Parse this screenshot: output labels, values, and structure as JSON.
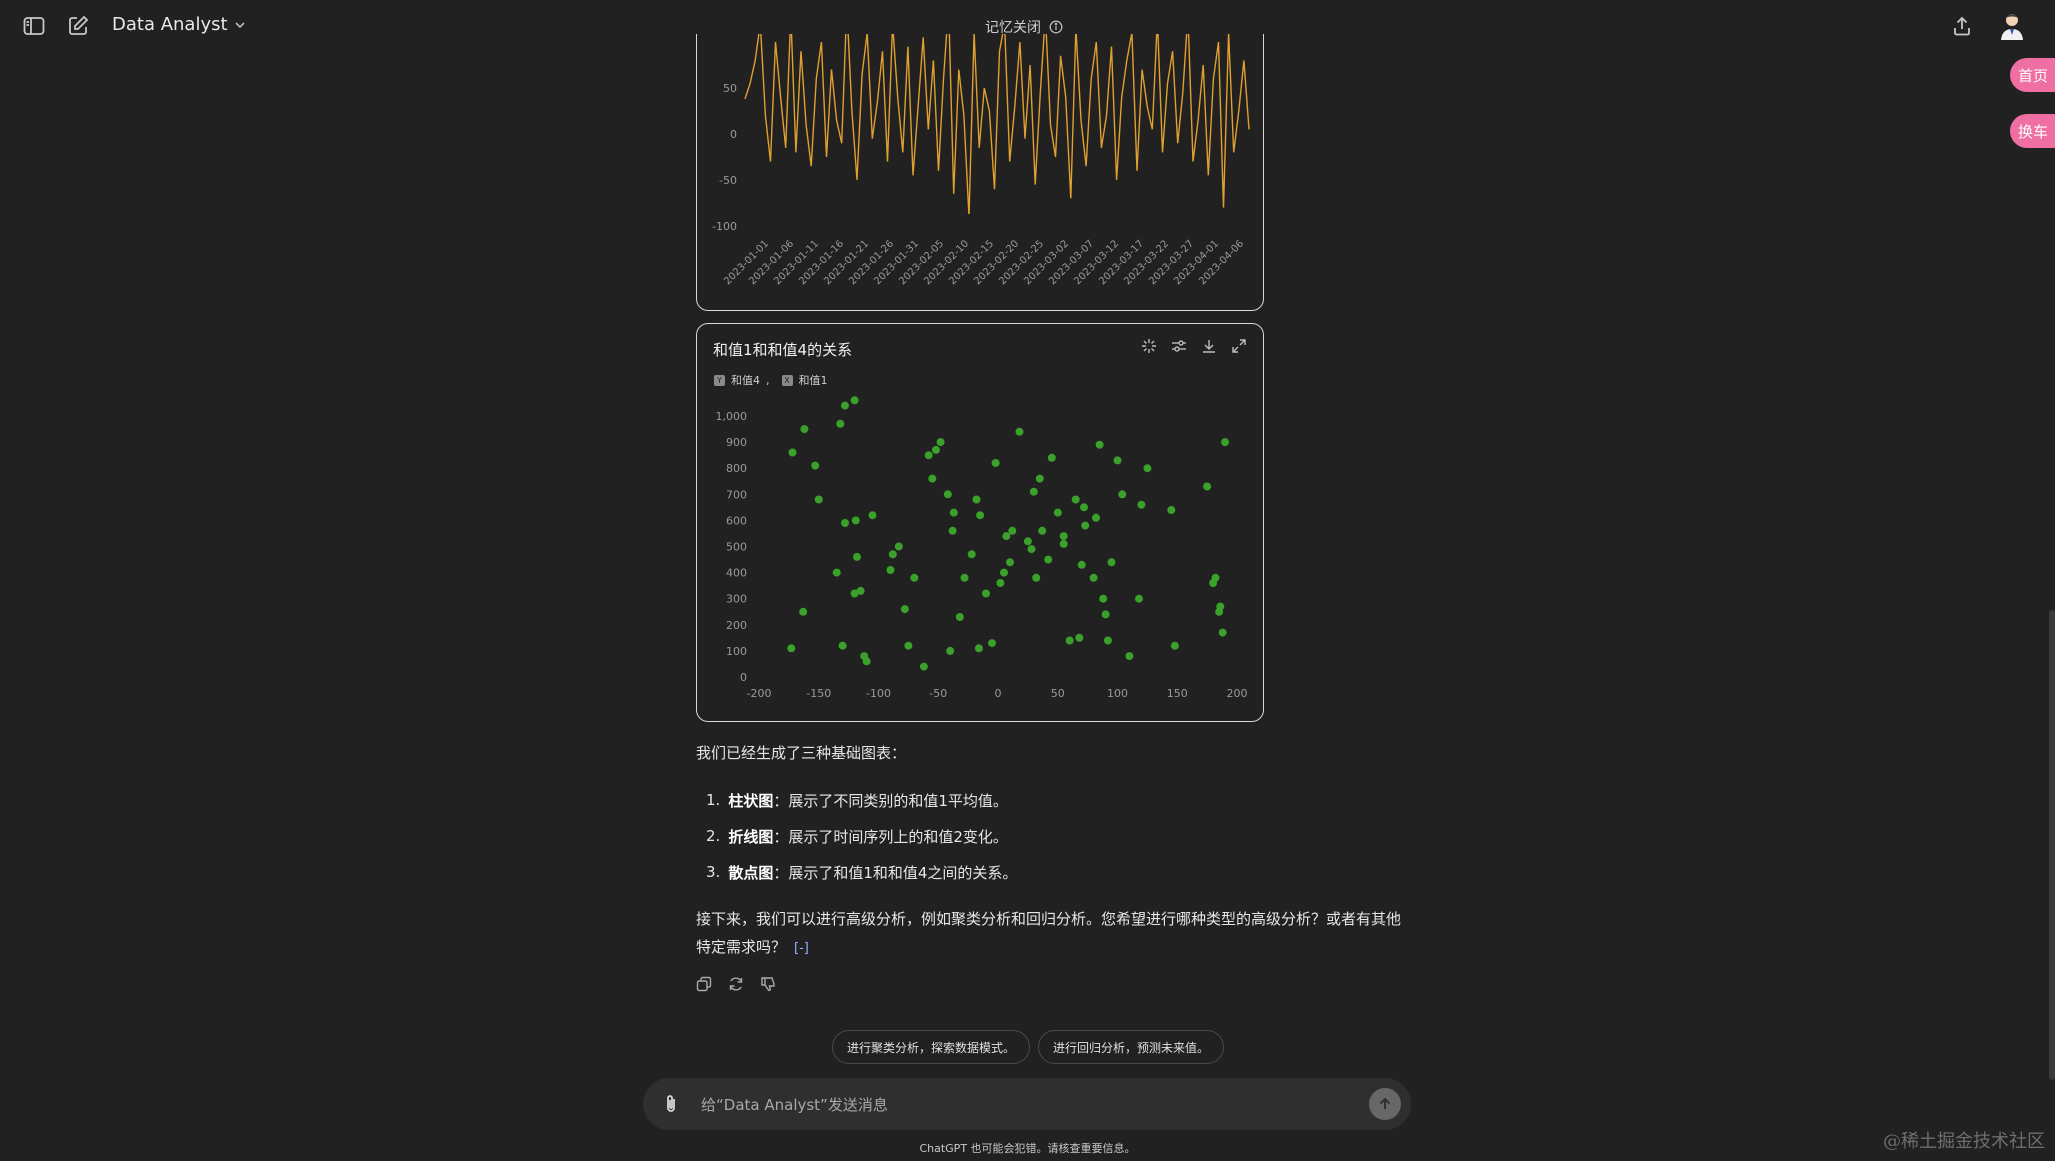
{
  "header": {
    "model_name": "Data Analyst",
    "memory_status": "记忆关闭"
  },
  "side_pills": {
    "home": "首页",
    "change": "换车"
  },
  "line_chart": {
    "y_ticks": [
      "50",
      "0",
      "-50",
      "-100"
    ],
    "x_ticks": [
      "2023-01-01",
      "2023-01-06",
      "2023-01-11",
      "2023-01-16",
      "2023-01-21",
      "2023-01-26",
      "2023-01-31",
      "2023-02-05",
      "2023-02-10",
      "2023-02-15",
      "2023-02-20",
      "2023-02-25",
      "2023-03-02",
      "2023-03-07",
      "2023-03-12",
      "2023-03-17",
      "2023-03-22",
      "2023-03-27",
      "2023-04-01",
      "2023-04-06"
    ]
  },
  "scatter_card": {
    "title": "和值1和和值4的关系",
    "legend_y_badge": "Y",
    "legend_y": "和值4",
    "legend_sep": ",",
    "legend_x_badge": "X",
    "legend_x": "和值1"
  },
  "chart_data": [
    {
      "type": "line",
      "y_ticks": [
        50,
        0,
        -50,
        -100
      ],
      "x_start": "2023-01-01",
      "x_end": "2023-04-10",
      "color": "#e0a030",
      "values": [
        38,
        55,
        80,
        120,
        20,
        -30,
        100,
        40,
        -15,
        130,
        -20,
        90,
        10,
        -35,
        60,
        100,
        -25,
        70,
        15,
        -10,
        140,
        25,
        -50,
        65,
        110,
        -5,
        35,
        90,
        -30,
        120,
        40,
        -20,
        95,
        -45,
        30,
        105,
        5,
        80,
        -40,
        60,
        140,
        -65,
        70,
        20,
        -90,
        110,
        -15,
        50,
        25,
        -60,
        90,
        120,
        -30,
        30,
        100,
        -5,
        75,
        -55,
        45,
        130,
        10,
        -25,
        85,
        40,
        -70,
        115,
        15,
        -35,
        60,
        100,
        -15,
        20,
        95,
        -50,
        40,
        80,
        110,
        -40,
        70,
        30,
        5,
        125,
        -20,
        55,
        90,
        -10,
        45,
        130,
        -30,
        15,
        75,
        -45,
        60,
        100,
        -80,
        110,
        -20,
        25,
        80,
        5
      ]
    },
    {
      "type": "scatter",
      "title": "和值1和和值4的关系",
      "x_label": "和值1",
      "y_label": "和值4",
      "xlim": [
        -200,
        200
      ],
      "ylim": [
        0,
        1000
      ],
      "x_ticks": [
        -200,
        -150,
        -100,
        -50,
        0,
        50,
        100,
        150,
        200
      ],
      "y_ticks": [
        "0",
        "100",
        "200",
        "300",
        "400",
        "500",
        "600",
        "700",
        "800",
        "900",
        "1,000"
      ],
      "color": "#3aa12a",
      "points": [
        [
          -172,
          860
        ],
        [
          -162,
          950
        ],
        [
          -153,
          810
        ],
        [
          -150,
          680
        ],
        [
          -173,
          110
        ],
        [
          -163,
          250
        ],
        [
          -135,
          400
        ],
        [
          -128,
          590
        ],
        [
          -120,
          320
        ],
        [
          -115,
          330
        ],
        [
          -118,
          460
        ],
        [
          -119,
          600
        ],
        [
          -110,
          60
        ],
        [
          -112,
          80
        ],
        [
          -130,
          120
        ],
        [
          -132,
          970
        ],
        [
          -128,
          1040
        ],
        [
          -120,
          1060
        ],
        [
          -105,
          620
        ],
        [
          -90,
          410
        ],
        [
          -88,
          470
        ],
        [
          -83,
          500
        ],
        [
          -78,
          260
        ],
        [
          -75,
          120
        ],
        [
          -70,
          380
        ],
        [
          -62,
          40
        ],
        [
          -55,
          760
        ],
        [
          -58,
          850
        ],
        [
          -48,
          900
        ],
        [
          -52,
          870
        ],
        [
          -42,
          700
        ],
        [
          -38,
          560
        ],
        [
          -37,
          630
        ],
        [
          -40,
          100
        ],
        [
          -32,
          230
        ],
        [
          -28,
          380
        ],
        [
          -22,
          470
        ],
        [
          -18,
          680
        ],
        [
          -15,
          620
        ],
        [
          -16,
          110
        ],
        [
          -10,
          320
        ],
        [
          -5,
          130
        ],
        [
          -2,
          820
        ],
        [
          2,
          360
        ],
        [
          5,
          400
        ],
        [
          7,
          540
        ],
        [
          10,
          440
        ],
        [
          12,
          560
        ],
        [
          18,
          940
        ],
        [
          25,
          520
        ],
        [
          28,
          490
        ],
        [
          30,
          710
        ],
        [
          32,
          380
        ],
        [
          35,
          760
        ],
        [
          37,
          560
        ],
        [
          42,
          450
        ],
        [
          45,
          840
        ],
        [
          50,
          630
        ],
        [
          55,
          540
        ],
        [
          55,
          510
        ],
        [
          60,
          140
        ],
        [
          65,
          680
        ],
        [
          68,
          150
        ],
        [
          70,
          430
        ],
        [
          72,
          650
        ],
        [
          73,
          580
        ],
        [
          80,
          380
        ],
        [
          82,
          610
        ],
        [
          85,
          890
        ],
        [
          88,
          300
        ],
        [
          90,
          240
        ],
        [
          92,
          140
        ],
        [
          95,
          440
        ],
        [
          100,
          830
        ],
        [
          104,
          700
        ],
        [
          110,
          80
        ],
        [
          118,
          300
        ],
        [
          120,
          660
        ],
        [
          125,
          800
        ],
        [
          145,
          640
        ],
        [
          148,
          120
        ],
        [
          175,
          730
        ],
        [
          180,
          360
        ],
        [
          182,
          380
        ],
        [
          185,
          250
        ],
        [
          186,
          270
        ],
        [
          188,
          170
        ],
        [
          190,
          900
        ]
      ]
    }
  ],
  "response": {
    "intro": "我们已经生成了三种基础图表：",
    "items": [
      {
        "num": "1.",
        "bold": "柱状图",
        "text": "：展示了不同类别的和值1平均值。"
      },
      {
        "num": "2.",
        "bold": "折线图",
        "text": "：展示了时间序列上的和值2变化。"
      },
      {
        "num": "3.",
        "bold": "散点图",
        "text": "：展示了和值1和和值4之间的关系。"
      }
    ],
    "followup": "接下来，我们可以进行高级分析，例如聚类分析和回归分析。您希望进行哪种类型的高级分析？或者有其他特定需求吗？",
    "ref": "[-]"
  },
  "suggestions": [
    "进行聚类分析，探索数据模式。",
    "进行回归分析，预测未来值。"
  ],
  "composer": {
    "placeholder": "给“Data Analyst”发送消息"
  },
  "footer": {
    "disclaimer": "ChatGPT 也可能会犯错。请核查重要信息。"
  },
  "watermark": "@稀土掘金技术社区"
}
